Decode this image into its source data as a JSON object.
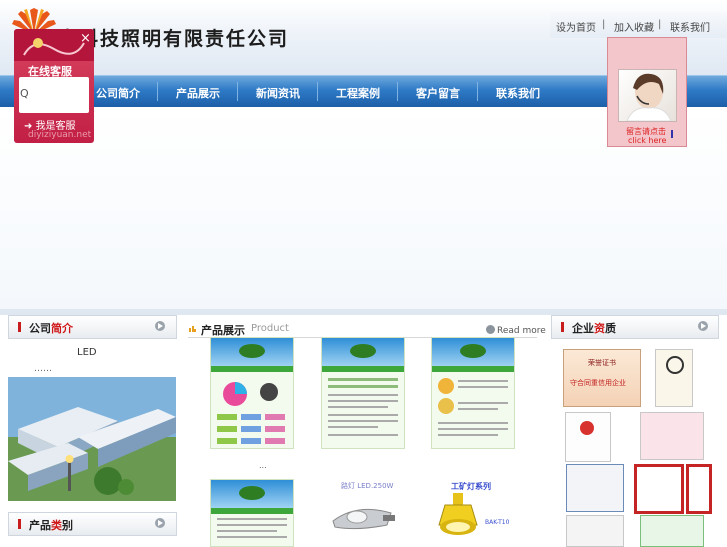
{
  "header": {
    "company_name": "光科技照明有限责任公司",
    "top_links": [
      "设为首页",
      "加入收藏",
      "联系我们"
    ],
    "separator": "|"
  },
  "nav": {
    "items": [
      "公司简介",
      "产品展示",
      "新闻资讯",
      "工程案例",
      "客户留言",
      "联系我们"
    ]
  },
  "floating_left": {
    "title": "在线客服",
    "close": "×",
    "qq_label": "Q",
    "me_label": "我是客服",
    "url": "diyiziyuan.net"
  },
  "floating_right": {
    "message": "留言请点击",
    "click": "click here"
  },
  "company_intro": {
    "title_prefix": "公司",
    "title_highlight": "简介",
    "text": "LED",
    "ellipsis": "……"
  },
  "products": {
    "title": "产品展示",
    "subtitle": "Product",
    "more": "Read more",
    "caption": "...",
    "street_light_label": "路灯 LED.250W",
    "mining_lamp_label": "工矿灯系列",
    "mining_lamp_sub": "BAK-T10"
  },
  "category": {
    "title_prefix": "产品",
    "title_highlight": "类",
    "title_suffix": "别"
  },
  "qualification": {
    "title_prefix": "企业",
    "title_highlight": "资",
    "title_suffix": "质",
    "cert_label": "荣誉证书",
    "cert_sub": "守合同重信用企业"
  },
  "colors": {
    "nav_blue": "#2f7ac6",
    "accent_red": "#d01818",
    "cs_red": "#c21f45",
    "cs_pink": "#f2c6cb"
  }
}
